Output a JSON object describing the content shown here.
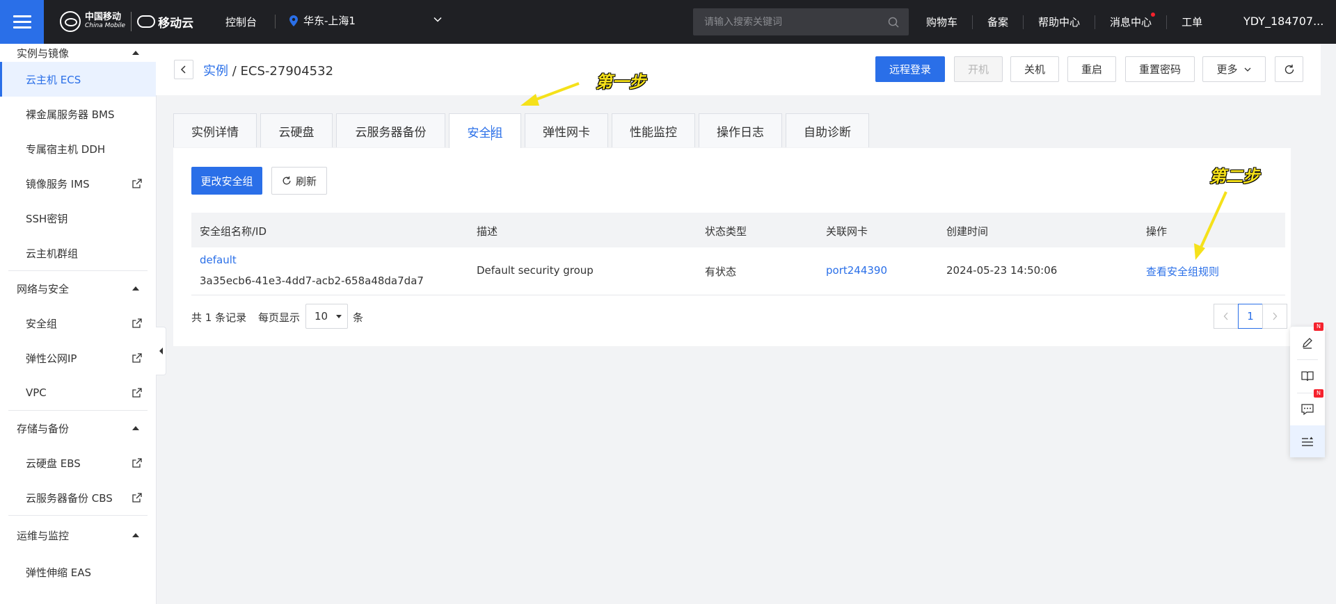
{
  "topbar": {
    "logo_cm_zh": "中国移动",
    "logo_cm_en": "China Mobile",
    "logo_cloud": "移动云",
    "console": "控制台",
    "region": "华东-上海1",
    "search_placeholder": "请输入搜索关键词",
    "links": [
      "购物车",
      "备案",
      "帮助中心",
      "消息中心",
      "工单"
    ],
    "user": "YDY_184707..."
  },
  "sidebar": {
    "groups": [
      {
        "title": "实例与镜像",
        "items": [
          {
            "label": "云主机 ECS",
            "active": true,
            "external": false
          },
          {
            "label": "裸金属服务器 BMS",
            "external": false
          },
          {
            "label": "专属宿主机 DDH",
            "external": false
          },
          {
            "label": "镜像服务 IMS",
            "external": true
          },
          {
            "label": "SSH密钥",
            "external": false
          },
          {
            "label": "云主机群组",
            "external": false
          }
        ]
      },
      {
        "title": "网络与安全",
        "items": [
          {
            "label": "安全组",
            "external": true
          },
          {
            "label": "弹性公网IP",
            "external": true
          },
          {
            "label": "VPC",
            "external": true
          }
        ]
      },
      {
        "title": "存储与备份",
        "items": [
          {
            "label": "云硬盘 EBS",
            "external": true
          },
          {
            "label": "云服务器备份 CBS",
            "external": true
          }
        ]
      },
      {
        "title": "运维与监控",
        "items": [
          {
            "label": "弹性伸缩 EAS",
            "external": false
          }
        ]
      }
    ]
  },
  "header": {
    "crumb_link": "实例",
    "crumb_sep": "/",
    "crumb_current": "ECS-27904532",
    "buttons": {
      "remote_login": "远程登录",
      "power_on": "开机",
      "power_off": "关机",
      "restart": "重启",
      "reset_password": "重置密码",
      "more": "更多"
    }
  },
  "tabs": [
    "实例详情",
    "云硬盘",
    "云服务器备份",
    "安全组",
    "弹性网卡",
    "性能监控",
    "操作日志",
    "自助诊断"
  ],
  "active_tab": "安全组",
  "panel": {
    "change_sg": "更改安全组",
    "refresh": "刷新",
    "columns": [
      "安全组名称/ID",
      "描述",
      "状态类型",
      "关联网卡",
      "创建时间",
      "操作"
    ],
    "rows": [
      {
        "name": "default",
        "id": "3a35ecb6-41e3-4dd7-acb2-658a48da7da7",
        "description": "Default security group",
        "state": "有状态",
        "nic": "port244390",
        "created": "2024-05-23 14:50:06",
        "action": "查看安全组规则"
      }
    ],
    "total_text": "共 1 条记录",
    "per_page_label": "每页显示",
    "per_page_value": "10",
    "per_page_unit": "条",
    "current_page": "1"
  },
  "annotations": {
    "step1": "第一步",
    "step2": "第二步"
  },
  "float_toolbar": {
    "badge": "N"
  },
  "colors": {
    "accent": "#2a6fe8",
    "topbar": "#1f2024",
    "annotation": "#f5e11a"
  }
}
